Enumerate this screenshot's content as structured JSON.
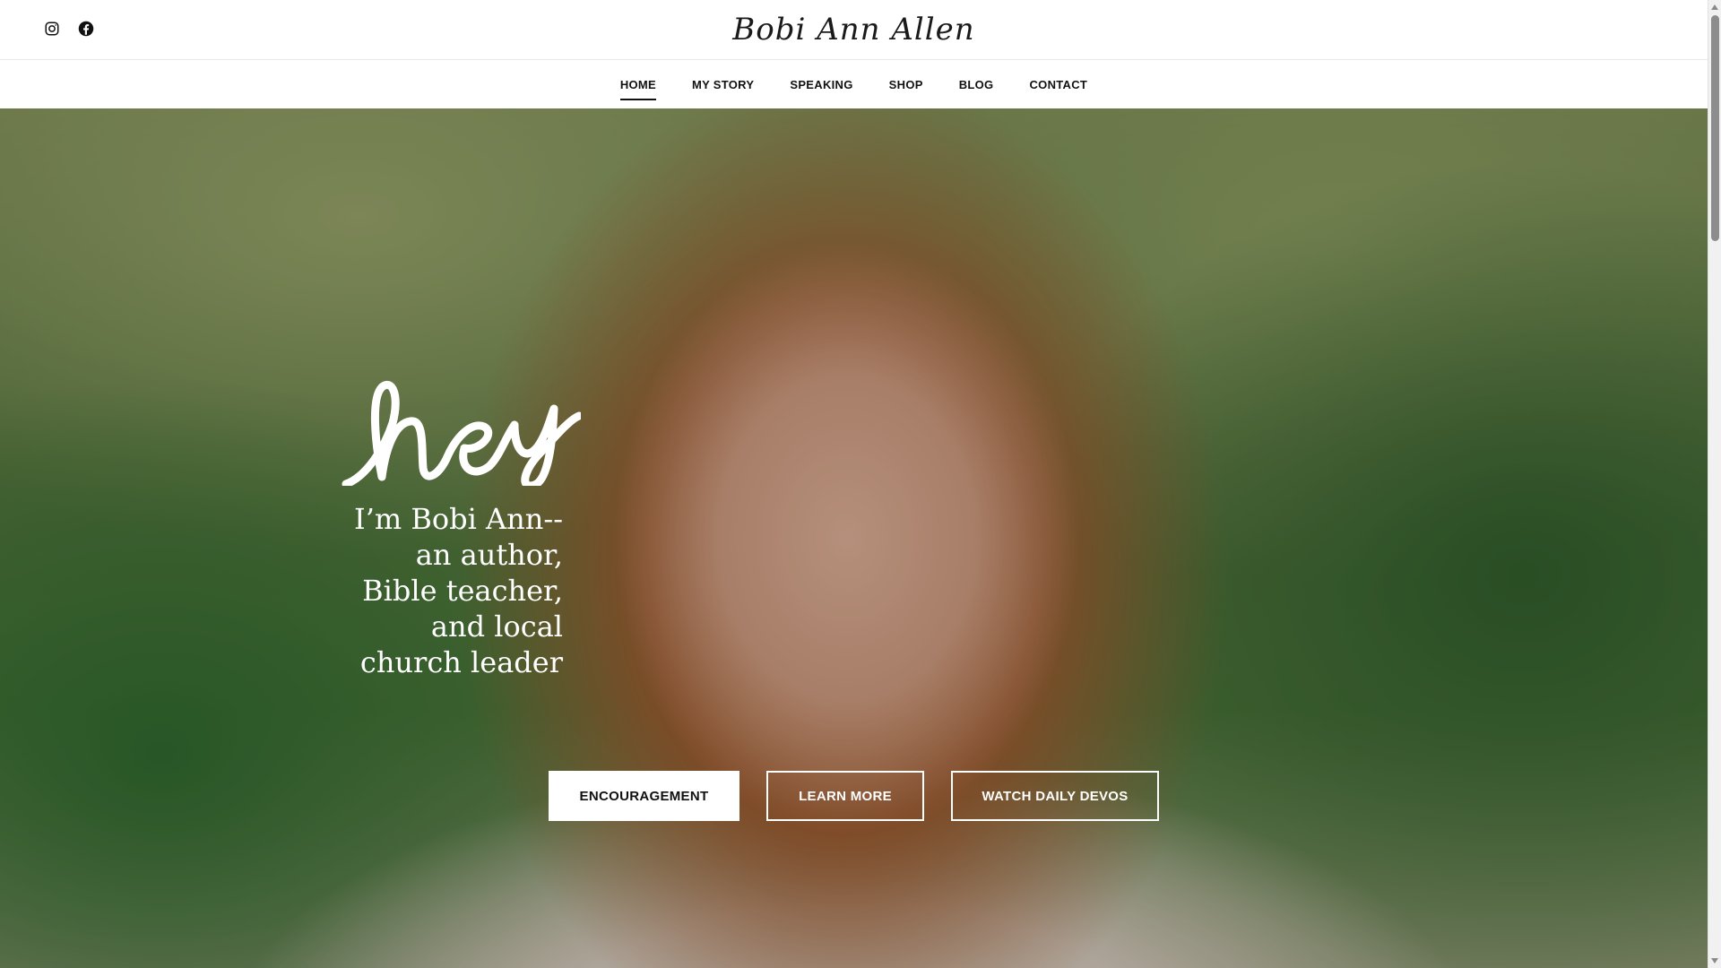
{
  "header": {
    "logo_text": "Bobi Ann Allen",
    "social": [
      {
        "icon": "instagram-icon"
      },
      {
        "icon": "facebook-icon"
      }
    ]
  },
  "nav": {
    "items": [
      {
        "label": "HOME",
        "active": true
      },
      {
        "label": "MY STORY",
        "active": false
      },
      {
        "label": "SPEAKING",
        "active": false
      },
      {
        "label": "SHOP",
        "active": false
      },
      {
        "label": "BLOG",
        "active": false
      },
      {
        "label": "CONTACT",
        "active": false
      }
    ]
  },
  "hero": {
    "script_word": "hey",
    "intro_lines": [
      "I’m Bobi Ann--",
      "an author,",
      "Bible teacher,",
      "and local",
      "church leader"
    ],
    "buttons": {
      "encouragement": "ENCOURAGEMENT",
      "learn_more": "LEARN MORE",
      "watch_devos": "WATCH DAILY DEVOS"
    }
  },
  "colors": {
    "text_dark": "#111111",
    "button_white": "#ffffff",
    "hero_overlay": "#141414"
  }
}
